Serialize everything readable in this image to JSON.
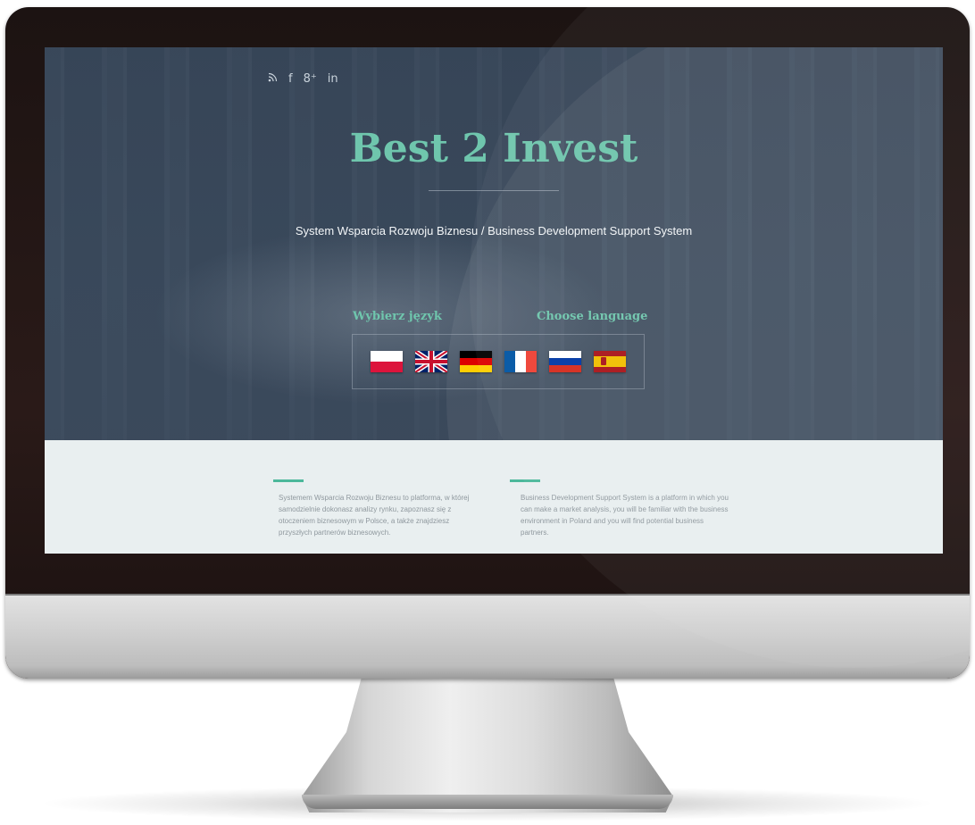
{
  "social": {
    "rss_icon": "rss-icon",
    "facebook_glyph": "f",
    "googleplus_glyph": "8⁺",
    "linkedin_glyph": "in"
  },
  "hero": {
    "title": "Best 2 Invest",
    "subtitle": "System Wsparcia Rozwoju Biznesu / Business Development Support System",
    "choose_pl": "Wybierz język",
    "choose_en": "Choose language"
  },
  "flags": [
    {
      "name": "flag-poland-icon"
    },
    {
      "name": "flag-uk-icon"
    },
    {
      "name": "flag-germany-icon"
    },
    {
      "name": "flag-france-icon"
    },
    {
      "name": "flag-russia-icon"
    },
    {
      "name": "flag-spain-icon"
    }
  ],
  "content": {
    "left_text": "Systemem Wsparcia Rozwoju Biznesu to platforma, w której samodzielnie dokonasz analizy rynku, zapoznasz się z otoczeniem biznesowym w Polsce, a także znajdziesz przyszłych partnerów biznesowych.",
    "right_text": "Business Development Support System is a platform in which you can make a market analysis, you will be familiar with the business environment in Poland and you will find potential business partners."
  },
  "colors": {
    "accent": "#6fc6ad",
    "hero_overlay": "#344254",
    "content_bg": "#e9eff0"
  }
}
